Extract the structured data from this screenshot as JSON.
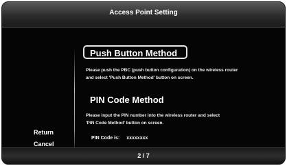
{
  "dialog": {
    "title": "Access Point Setting",
    "page_indicator": "2 / 7"
  },
  "side_menu": {
    "return_label": "Return",
    "cancel_label": "Cancel"
  },
  "push_button": {
    "label": "Push Button Method",
    "desc_line1": "Please push the PBC (push button configuration) on the wireless router",
    "desc_line2": "and select 'Push Button Method' button on screen."
  },
  "pin_code": {
    "label": "PIN Code Method",
    "desc_line1": "Please input the PIN number into the wireless router and select",
    "desc_line2": "'PIN Code Method' button on screen.",
    "pin_label": "PIN Code is:",
    "pin_value": "xxxxxxxx"
  }
}
